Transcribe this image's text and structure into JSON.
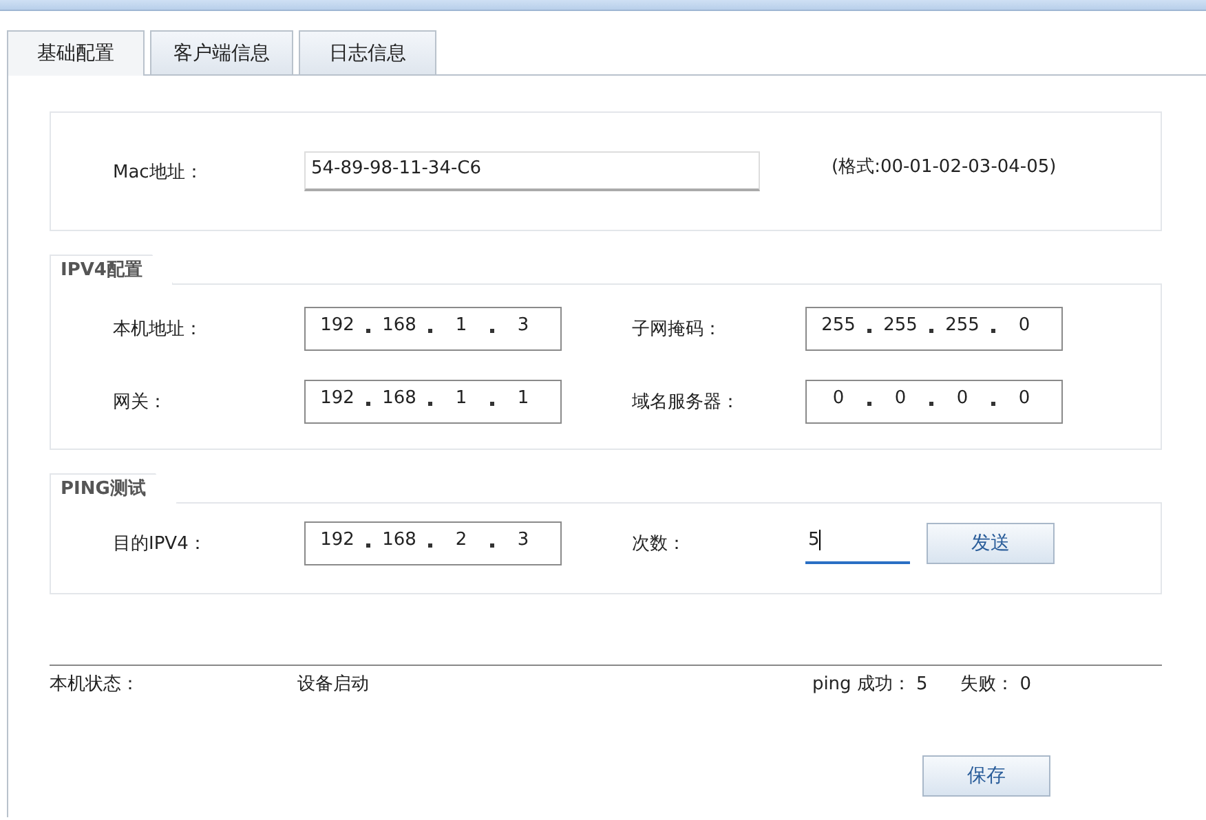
{
  "tabs": [
    {
      "label": "基础配置",
      "selected": true
    },
    {
      "label": "客户端信息",
      "selected": false
    },
    {
      "label": "日志信息",
      "selected": false
    }
  ],
  "mac": {
    "label": "Mac地址：",
    "value": "54-89-98-11-34-C6",
    "hint": "(格式:00-01-02-03-04-05)"
  },
  "ipv4": {
    "title": "IPV4配置",
    "fields": [
      {
        "label": "本机地址：",
        "octets": [
          "192",
          "168",
          "1",
          "3"
        ]
      },
      {
        "label": "子网掩码：",
        "octets": [
          "255",
          "255",
          "255",
          "0"
        ]
      },
      {
        "label": "网关：",
        "octets": [
          "192",
          "168",
          "1",
          "1"
        ]
      },
      {
        "label": "域名服务器：",
        "octets": [
          "0",
          "0",
          "0",
          "0"
        ]
      }
    ]
  },
  "ping": {
    "title": "PING测试",
    "target": {
      "label": "目的IPV4：",
      "octets": [
        "192",
        "168",
        "2",
        "3"
      ]
    },
    "count": {
      "label": "次数：",
      "value": "5",
      "focused": true
    },
    "send_button": "发送"
  },
  "status": {
    "label": "本机状态：",
    "value": "设备启动",
    "success_label": "ping 成功：",
    "success": "5",
    "fail_label": "失败：",
    "fail": "0"
  },
  "save_button": "保存"
}
